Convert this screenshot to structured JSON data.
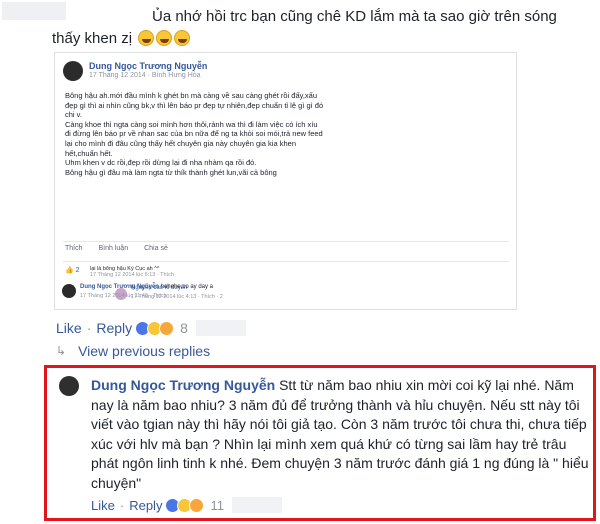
{
  "top_comment": {
    "line1": "Ủa nhớ hồi trc bạn cũng chê KD lắm mà ta sao giờ trên sóng",
    "line2": "thấy khen zị"
  },
  "embedded_post": {
    "author": "Dung Ngọc Trương Nguyễn",
    "meta": "17 Tháng 12 2014 · Bình Hưng Hòa",
    "body": "Bông hậu ah.mới đầu mình k ghét bn mà càng về sau càng ghét rồi đấy,xấu\nđẹp gì thì ai nhìn cũng bk,v thì lên báo pr đẹp tự nhiên,đẹp chuẩn tỉ lệ gì gì đó\nchi v.\nCàng khoe thì ngta càng soi mình hơn thôi,rảnh wa thì đi làm việc có ích xíu\nđi đừng lên báo pr về nhan sac của bn nữa để ng ta khỏi soi mói,trả new feed\nlại cho mình đi đâu cũng thấy hết chuyên gia này chuyên gia kia khen\nhết,chuẩn hết.\nUhm khen v dc rồi,đẹp rồi dừng lại đi nha nhàm qa rồi đó.\nBông hậu gì đâu mà làm ngta từ thík thành ghét lun,vãi cả bông",
    "actions": [
      "Thích",
      "Bình luận",
      "Chia sẻ"
    ],
    "reaction_count": "2",
    "comment1_name": "Nguyễn cao kì duyên",
    "comment1_meta": "17 Tháng 12 2014 lúc 4:13 · Thích · 2",
    "comment2_text": "lại là bông hậu Kỳ Cục ah ^^",
    "comment2_meta": "17 Tháng 12 2014 lúc 6:13 · Thích",
    "comment3_name": "Dung Ngọc Trương Nguyễn",
    "comment3_text": "hehehe,co ay day a",
    "comment3_meta": "17 Tháng 12 2014 lúc 11:40 · Thích"
  },
  "comment_actions": {
    "like": "Like",
    "reply": "Reply",
    "count": "8"
  },
  "view_previous": "View previous replies",
  "highlighted_reply": {
    "author": "Dung Ngọc Trương Nguyễn",
    "text": "Stt từ năm bao nhiu xin mời coi kỹ lại nhé. Năm nay là năm bao nhiu? 3 năm đủ để trưởng thành và hỉu chuyện. Nếu stt này tôi viết vào tgian này thì hãy nói tôi giả tạo. Còn 3 năm trước tôi chưa thi, chưa tiếp xúc với hlv mà bạn ? Nhìn lại mình xem quá khứ có từng sai lầm hay trẻ trâu phát ngôn linh tinh k nhé. Đem chuyện 3 năm trước đánh giá 1 ng đúng là \" hiểu chuyện\"",
    "like": "Like",
    "reply": "Reply",
    "count": "11"
  },
  "colors": {
    "link": "#365899",
    "highlight_border": "#e0161c",
    "muted": "#90949c"
  }
}
